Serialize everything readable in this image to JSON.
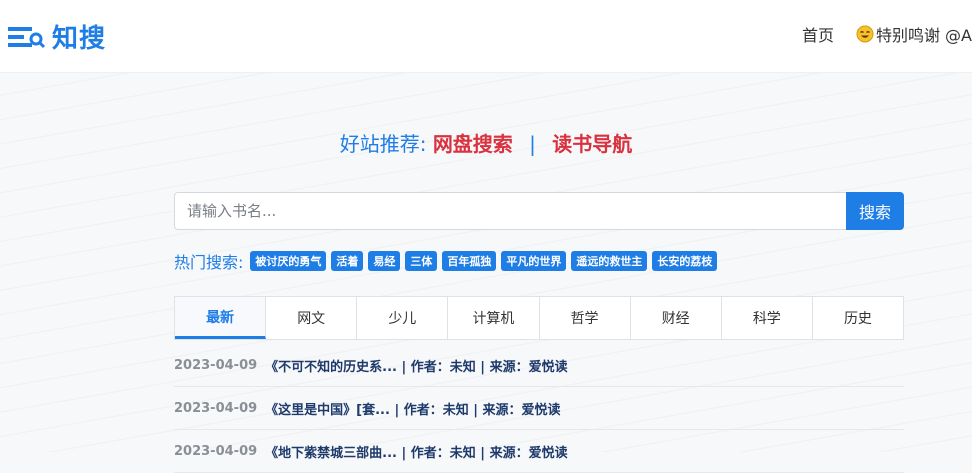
{
  "header": {
    "logo_text": "知搜",
    "nav": {
      "home": "首页",
      "thanks": "特别鸣谢 @A"
    }
  },
  "recommend": {
    "label": "好站推荐:",
    "links": [
      "网盘搜索",
      "读书导航"
    ],
    "separator": "|"
  },
  "search": {
    "placeholder": "请输入书名...",
    "value": "",
    "button": "搜索"
  },
  "hot": {
    "label": "热门搜索:",
    "tags": [
      "被讨厌的勇气",
      "活着",
      "易经",
      "三体",
      "百年孤独",
      "平凡的世界",
      "遥远的救世主",
      "长安的荔枝"
    ]
  },
  "tabs": [
    "最新",
    "网文",
    "少儿",
    "计算机",
    "哲学",
    "财经",
    "科学",
    "历史"
  ],
  "active_tab": "最新",
  "list": [
    {
      "date": "2023-04-09",
      "text": "《不可不知的历史系... | 作者：未知 | 来源：爱悦读"
    },
    {
      "date": "2023-04-09",
      "text": "《这里是中国》[套... | 作者：未知 | 来源：爱悦读"
    },
    {
      "date": "2023-04-09",
      "text": "《地下紫禁城三部曲... | 作者：未知 | 来源：爱悦读"
    }
  ],
  "colors": {
    "accent": "#1f7de6",
    "highlight": "#d9323f"
  },
  "icons": {
    "logo": "search-list-icon",
    "thanks": "smile-emoji-icon"
  }
}
